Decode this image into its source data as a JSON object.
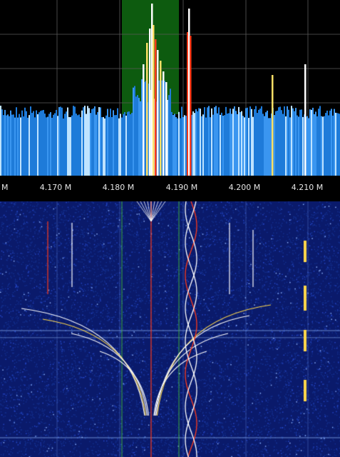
{
  "spectrum": {
    "background": "#000000",
    "grid_color": "#5a5a5a",
    "bar_color": "#1e7bd9",
    "selection_color": "#0f6b12",
    "peak_colors": [
      "#ffffff",
      "#ffe066",
      "#ff3b1a"
    ]
  },
  "frequency_axis": {
    "unit_suffix": "M",
    "ticks": [
      {
        "id": "edge",
        "label": "M"
      },
      {
        "id": "4170",
        "label": "4.170 M"
      },
      {
        "id": "4180",
        "label": "4.180 M"
      },
      {
        "id": "4190",
        "label": "4.190 M"
      },
      {
        "id": "4200",
        "label": "4.200 M"
      },
      {
        "id": "4210",
        "label": "4.210 M"
      }
    ]
  },
  "waterfall": {
    "background": "#0a1a6b",
    "trace_colors": [
      "#ffffff",
      "#ff3b1a",
      "#ffd84a"
    ]
  }
}
